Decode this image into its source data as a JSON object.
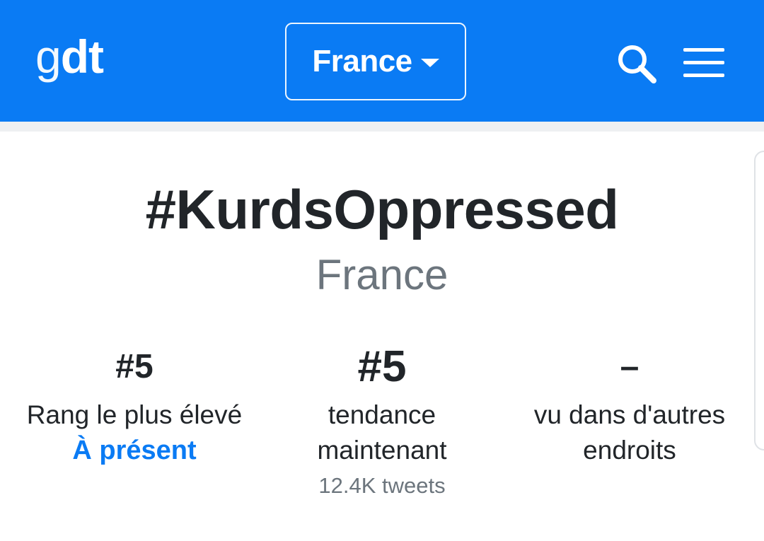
{
  "header": {
    "logo_g": "g",
    "logo_dt": "dt",
    "country_selector": "France",
    "accent_color": "#0a7bf4",
    "icons": [
      "search-icon",
      "hamburger-menu-icon",
      "caret-down-icon"
    ]
  },
  "trend": {
    "hashtag": "#KurdsOppressed",
    "country": "France"
  },
  "stats": [
    {
      "value": "#5",
      "description": "Rang le plus élevé",
      "link": "À présent"
    },
    {
      "value": "#5",
      "description": "tendance maintenant",
      "sub": "12.4K tweets"
    },
    {
      "value": "–",
      "description": "vu dans d'autres endroits"
    }
  ]
}
